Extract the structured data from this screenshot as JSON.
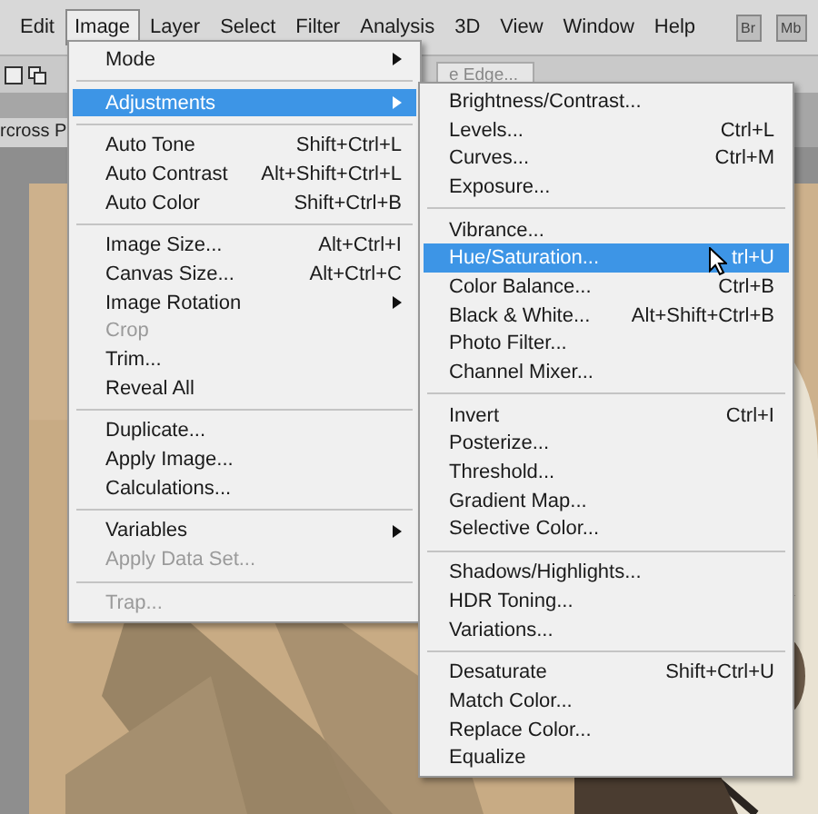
{
  "menu_bar": [
    {
      "label": "Edit",
      "selected": false
    },
    {
      "label": "Image",
      "selected": true
    },
    {
      "label": "Layer",
      "selected": false
    },
    {
      "label": "Select",
      "selected": false
    },
    {
      "label": "Filter",
      "selected": false
    },
    {
      "label": "Analysis",
      "selected": false
    },
    {
      "label": "3D",
      "selected": false
    },
    {
      "label": "View",
      "selected": false
    },
    {
      "label": "Window",
      "selected": false
    },
    {
      "label": "Help",
      "selected": false
    }
  ],
  "app_buttons": [
    "Br",
    "Mb"
  ],
  "options_bar": {
    "button": "e Edge..."
  },
  "document_tab": {
    "title": "rcross P"
  },
  "image_menu": [
    {
      "kind": "item",
      "label": "Mode",
      "has_submenu": true,
      "disabled": false,
      "selected": false
    },
    {
      "kind": "separator"
    },
    {
      "kind": "item",
      "label": "Adjustments",
      "has_submenu": true,
      "disabled": false,
      "selected": true
    },
    {
      "kind": "separator"
    },
    {
      "kind": "item",
      "label": "Auto Tone",
      "shortcut": "Shift+Ctrl+L",
      "has_submenu": false,
      "disabled": false,
      "selected": false
    },
    {
      "kind": "item",
      "label": "Auto Contrast",
      "shortcut": "Alt+Shift+Ctrl+L",
      "has_submenu": false,
      "disabled": false,
      "selected": false
    },
    {
      "kind": "item",
      "label": "Auto Color",
      "shortcut": "Shift+Ctrl+B",
      "has_submenu": false,
      "disabled": false,
      "selected": false
    },
    {
      "kind": "separator"
    },
    {
      "kind": "item",
      "label": "Image Size...",
      "shortcut": "Alt+Ctrl+I",
      "has_submenu": false,
      "disabled": false,
      "selected": false
    },
    {
      "kind": "item",
      "label": "Canvas Size...",
      "shortcut": "Alt+Ctrl+C",
      "has_submenu": false,
      "disabled": false,
      "selected": false
    },
    {
      "kind": "item",
      "label": "Image Rotation",
      "has_submenu": true,
      "disabled": false,
      "selected": false
    },
    {
      "kind": "item",
      "label": "Crop",
      "has_submenu": false,
      "disabled": true,
      "selected": false
    },
    {
      "kind": "item",
      "label": "Trim...",
      "has_submenu": false,
      "disabled": false,
      "selected": false
    },
    {
      "kind": "item",
      "label": "Reveal All",
      "has_submenu": false,
      "disabled": false,
      "selected": false
    },
    {
      "kind": "separator"
    },
    {
      "kind": "item",
      "label": "Duplicate...",
      "has_submenu": false,
      "disabled": false,
      "selected": false
    },
    {
      "kind": "item",
      "label": "Apply Image...",
      "has_submenu": false,
      "disabled": false,
      "selected": false
    },
    {
      "kind": "item",
      "label": "Calculations...",
      "has_submenu": false,
      "disabled": false,
      "selected": false
    },
    {
      "kind": "separator"
    },
    {
      "kind": "item",
      "label": "Variables",
      "has_submenu": true,
      "disabled": false,
      "selected": false
    },
    {
      "kind": "item",
      "label": "Apply Data Set...",
      "has_submenu": false,
      "disabled": true,
      "selected": false
    },
    {
      "kind": "separator"
    },
    {
      "kind": "item",
      "label": "Trap...",
      "has_submenu": false,
      "disabled": true,
      "selected": false
    }
  ],
  "adjustments_menu": [
    {
      "kind": "item",
      "label": "Brightness/Contrast...",
      "selected": false
    },
    {
      "kind": "item",
      "label": "Levels...",
      "shortcut": "Ctrl+L",
      "selected": false
    },
    {
      "kind": "item",
      "label": "Curves...",
      "shortcut": "Ctrl+M",
      "selected": false
    },
    {
      "kind": "item",
      "label": "Exposure...",
      "selected": false
    },
    {
      "kind": "separator"
    },
    {
      "kind": "item",
      "label": "Vibrance...",
      "selected": false
    },
    {
      "kind": "item",
      "label": "Hue/Saturation...",
      "shortcut": "trl+U",
      "selected": true
    },
    {
      "kind": "item",
      "label": "Color Balance...",
      "shortcut": "Ctrl+B",
      "selected": false
    },
    {
      "kind": "item",
      "label": "Black & White...",
      "shortcut": "Alt+Shift+Ctrl+B",
      "selected": false
    },
    {
      "kind": "item",
      "label": "Photo Filter...",
      "selected": false
    },
    {
      "kind": "item",
      "label": "Channel Mixer...",
      "selected": false
    },
    {
      "kind": "separator"
    },
    {
      "kind": "item",
      "label": "Invert",
      "shortcut": "Ctrl+I",
      "selected": false
    },
    {
      "kind": "item",
      "label": "Posterize...",
      "selected": false
    },
    {
      "kind": "item",
      "label": "Threshold...",
      "selected": false
    },
    {
      "kind": "item",
      "label": "Gradient Map...",
      "selected": false
    },
    {
      "kind": "item",
      "label": "Selective Color...",
      "selected": false
    },
    {
      "kind": "separator"
    },
    {
      "kind": "item",
      "label": "Shadows/Highlights...",
      "selected": false
    },
    {
      "kind": "item",
      "label": "HDR Toning...",
      "selected": false
    },
    {
      "kind": "item",
      "label": "Variations...",
      "selected": false
    },
    {
      "kind": "separator"
    },
    {
      "kind": "item",
      "label": "Desaturate",
      "shortcut": "Shift+Ctrl+U",
      "selected": false
    },
    {
      "kind": "item",
      "label": "Match Color...",
      "selected": false
    },
    {
      "kind": "item",
      "label": "Replace Color...",
      "selected": false
    },
    {
      "kind": "item",
      "label": "Equalize",
      "selected": false
    }
  ]
}
